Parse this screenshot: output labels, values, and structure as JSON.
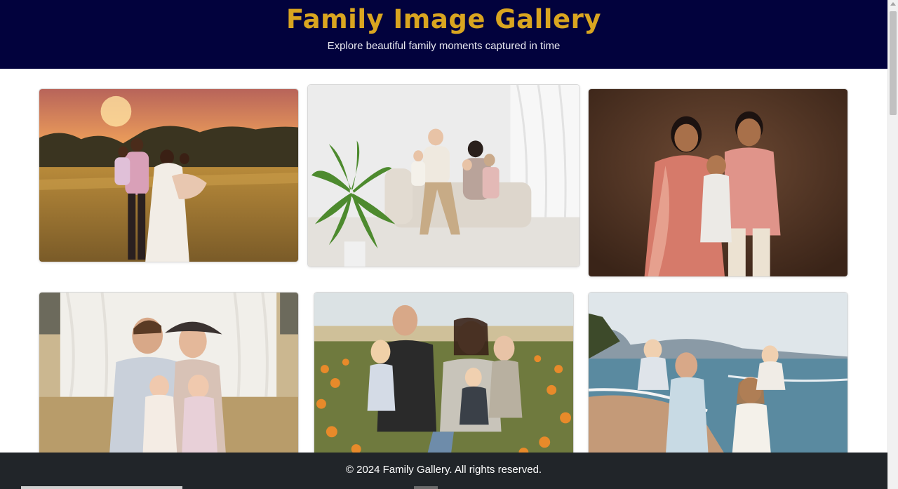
{
  "header": {
    "title": "Family Image Gallery",
    "subtitle": "Explore beautiful family moments captured in time"
  },
  "gallery": {
    "items": [
      {
        "icon": "family-photo-sunset-field"
      },
      {
        "icon": "family-photo-white-studio-sofa"
      },
      {
        "icon": "family-photo-traditional-attire"
      },
      {
        "icon": "family-photo-outdoor-white-curtains"
      },
      {
        "icon": "family-photo-flower-field"
      },
      {
        "icon": "family-photo-beach"
      }
    ]
  },
  "footer": {
    "copyright": "© 2024 Family Gallery. All rights reserved."
  },
  "colors": {
    "header_bg": "#02023d",
    "title": "#d9a520",
    "footer_bg": "#212529"
  }
}
